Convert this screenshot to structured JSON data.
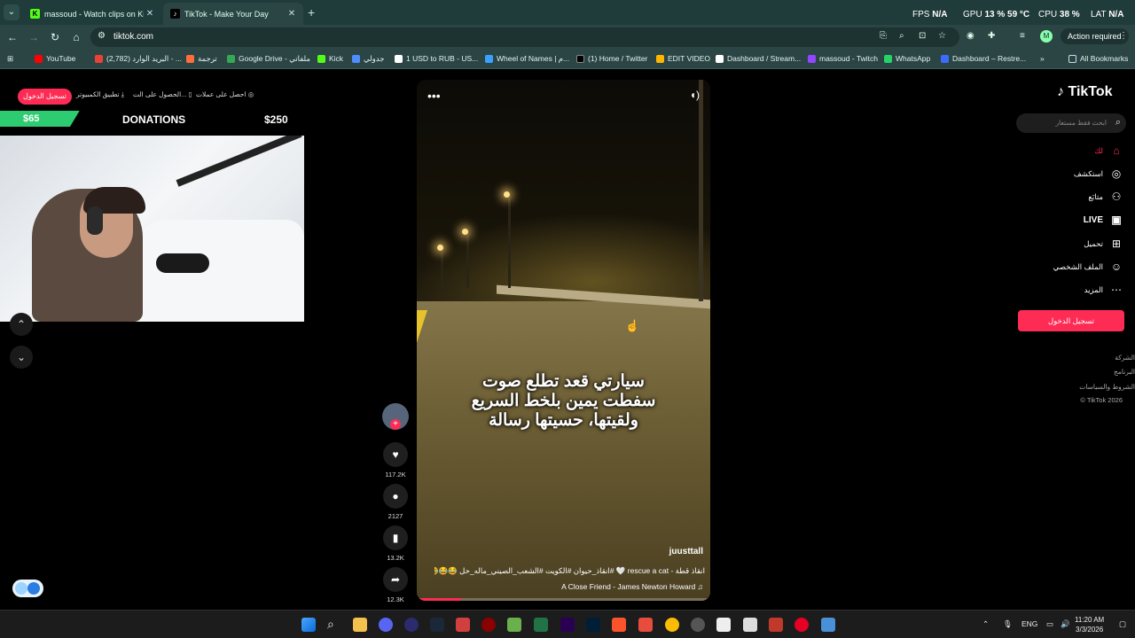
{
  "browser": {
    "tabs": [
      {
        "title": "massoud - Watch clips on Kick",
        "active": false
      },
      {
        "title": "TikTok - Make Your Day",
        "active": true
      }
    ],
    "new_tab": "+",
    "close": "✕",
    "url": "tiktok.com",
    "action_required": "Action required",
    "avatar_letter": "M",
    "bookmarks": [
      {
        "label": "YouTube",
        "color": "#ff0000"
      },
      {
        "label": "(2,782) البريد الوارد - ...",
        "color": "#ea4335"
      },
      {
        "label": "ترجمة",
        "color": "#ff6d3a"
      },
      {
        "label": "Google Drive - ملفاتي",
        "color": "#34a853"
      },
      {
        "label": "Kick",
        "color": "#53fc18"
      },
      {
        "label": "جدولي",
        "color": "#4f8cff"
      },
      {
        "label": "1 USD to RUB - US...",
        "color": "#ffffff"
      },
      {
        "label": "Wheel of Names | م...",
        "color": "#3aa0ff"
      },
      {
        "label": "(1) Home / Twitter",
        "color": "#000000"
      },
      {
        "label": "EDIT VIDEO",
        "color": "#ffb400"
      },
      {
        "label": "Dashboard / Stream...",
        "color": "#ffffff"
      },
      {
        "label": "massoud - Twitch",
        "color": "#9146ff"
      },
      {
        "label": "WhatsApp",
        "color": "#25d366"
      },
      {
        "label": "Dashboard – Restre...",
        "color": "#3c6cff"
      }
    ],
    "all_bookmarks": "All Bookmarks",
    "stats": {
      "fps_label": "FPS",
      "fps_value": "N/A",
      "gpu_label": "GPU",
      "gpu_value": "13 %",
      "gpu_temp": "59 °C",
      "cpu_label": "CPU",
      "cpu_value": "38 %",
      "lat_label": "LAT",
      "lat_value": "N/A"
    }
  },
  "stream_overlay": {
    "login": "تسجيل الدخول",
    "desktop_app": "تطبيق الكمبيوتر",
    "get_app": "الحصول على الت...",
    "get_coins": "احصل على عملات",
    "donations_label": "DONATIONS",
    "donations_current": "$65",
    "donations_goal": "$250",
    "donations_progress": 0.26
  },
  "video": {
    "caption_lines": [
      "سيارتي قعد تطلع صوت",
      "سفطت يمين بلخط السريع",
      "ولقيتها، حسيتها رسالة"
    ],
    "author": "juusttall",
    "description": "انقاذ قطة - rescue a cat 🤍 #انقاذ_حيوان  #الكويت #الشعب_الصيني_ماله_حل 😂😂😂",
    "music": "A Close Friend - James Newton Howard",
    "progress": 0.15
  },
  "actions": {
    "likes": "117.2K",
    "comments": "2127",
    "saves": "13.2K",
    "shares": "12.3K"
  },
  "tiktok_nav": {
    "logo": "TikTok",
    "search_placeholder": "ابحث فقط مستعار",
    "items": [
      {
        "label": "لك",
        "icon": "home-icon",
        "active": true
      },
      {
        "label": "استكشف",
        "icon": "compass-icon",
        "active": false
      },
      {
        "label": "متابَع",
        "icon": "following-icon",
        "active": false
      },
      {
        "label": "LIVE",
        "icon": "live-icon",
        "active": false
      },
      {
        "label": "تحميل",
        "icon": "upload-icon",
        "active": false
      },
      {
        "label": "الملف الشخصي",
        "icon": "profile-icon",
        "active": false
      },
      {
        "label": "المزيد",
        "icon": "more-icon",
        "active": false
      }
    ],
    "login_button": "تسجيل الدخول",
    "footer": [
      "الشركة",
      "البرنامج",
      "الشروط والسياسات",
      "© TikTok 2026"
    ]
  },
  "taskbar": {
    "language": "ENG",
    "time": "11:20 AM",
    "date": "3/3/2026"
  },
  "colors": {
    "tiktok_red": "#fe2c55",
    "chrome_frame": "#1f3b3a",
    "donation_green": "#2ecc71"
  }
}
